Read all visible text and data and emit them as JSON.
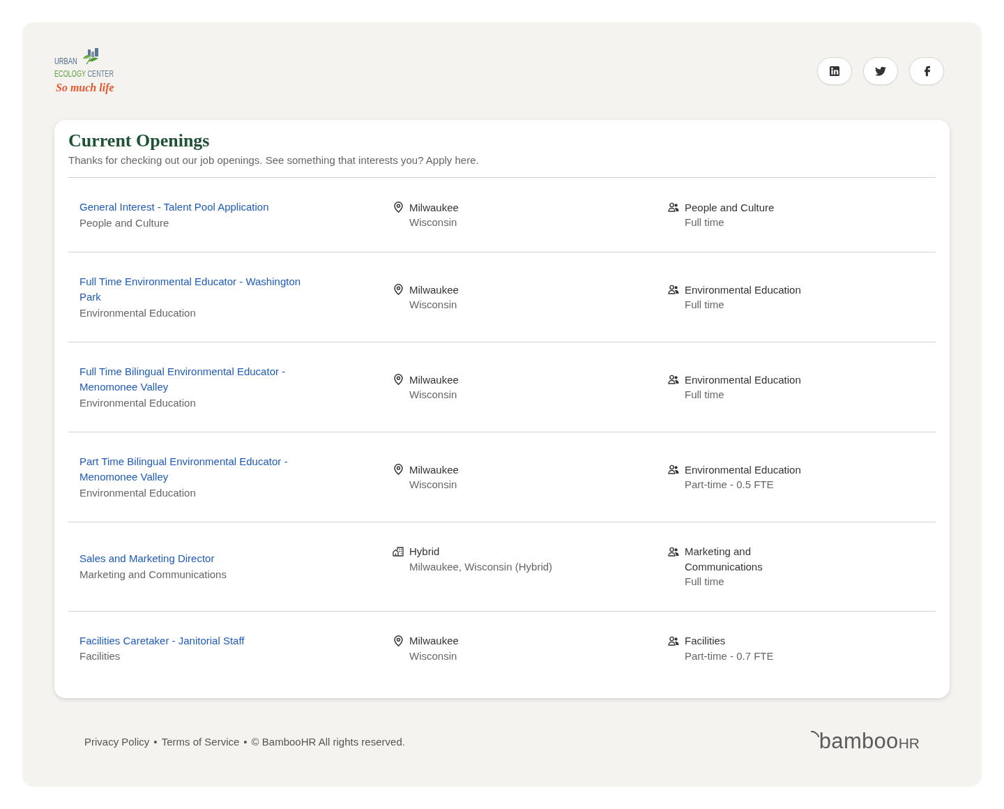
{
  "header": {
    "logo": {
      "line_1": "URBAN",
      "line_2": [
        "ECOLOGY",
        "CENTER"
      ],
      "tagline": "So much life"
    },
    "social_links": [
      {
        "kind": "linkedin"
      },
      {
        "kind": "twitter"
      },
      {
        "kind": "facebook"
      }
    ]
  },
  "openings": {
    "title": "Current Openings",
    "subtitle": "Thanks for checking out our job openings. See something that interests you? Apply here.",
    "jobs": [
      {
        "title": "General Interest - Talent Pool Application",
        "department": "People and Culture",
        "location": {
          "kind": "onsite",
          "line_1": "Milwaukee",
          "line_2": "Wisconsin"
        },
        "team": "People and Culture",
        "employment_type": "Full time"
      },
      {
        "title": "Full Time Environmental Educator - Washington Park",
        "department": "Environmental Education",
        "location": {
          "kind": "onsite",
          "line_1": "Milwaukee",
          "line_2": "Wisconsin"
        },
        "team": "Environmental Education",
        "employment_type": "Full time"
      },
      {
        "title": "Full Time Bilingual Environmental Educator - Menomonee Valley",
        "department": "Environmental Education",
        "location": {
          "kind": "onsite",
          "line_1": "Milwaukee",
          "line_2": "Wisconsin"
        },
        "team": "Environmental Education",
        "employment_type": "Full time"
      },
      {
        "title": "Part Time Bilingual Environmental Educator - Menomonee Valley",
        "department": "Environmental Education",
        "location": {
          "kind": "onsite",
          "line_1": "Milwaukee",
          "line_2": "Wisconsin"
        },
        "team": "Environmental Education",
        "employment_type": "Part-time - 0.5 FTE"
      },
      {
        "title": "Sales and Marketing Director",
        "department": "Marketing and Communications",
        "location": {
          "kind": "hybrid",
          "line_1": "Hybrid",
          "line_2": "Milwaukee, Wisconsin (Hybrid)"
        },
        "team": "Marketing and Communications",
        "employment_type": "Full time"
      },
      {
        "title": "Facilities Caretaker - Janitorial Staff",
        "department": "Facilities",
        "location": {
          "kind": "onsite",
          "line_1": "Milwaukee",
          "line_2": "Wisconsin"
        },
        "team": "Facilities",
        "employment_type": "Part-time - 0.7 FTE"
      }
    ]
  },
  "footer": {
    "links": [
      {
        "text": "Privacy Policy",
        "separator": "•"
      },
      {
        "text": "Terms of Service",
        "separator": "•"
      }
    ],
    "copyright": "© BambooHR All rights reserved.",
    "brand": {
      "name": "bamboo",
      "suffix": "HR"
    }
  }
}
